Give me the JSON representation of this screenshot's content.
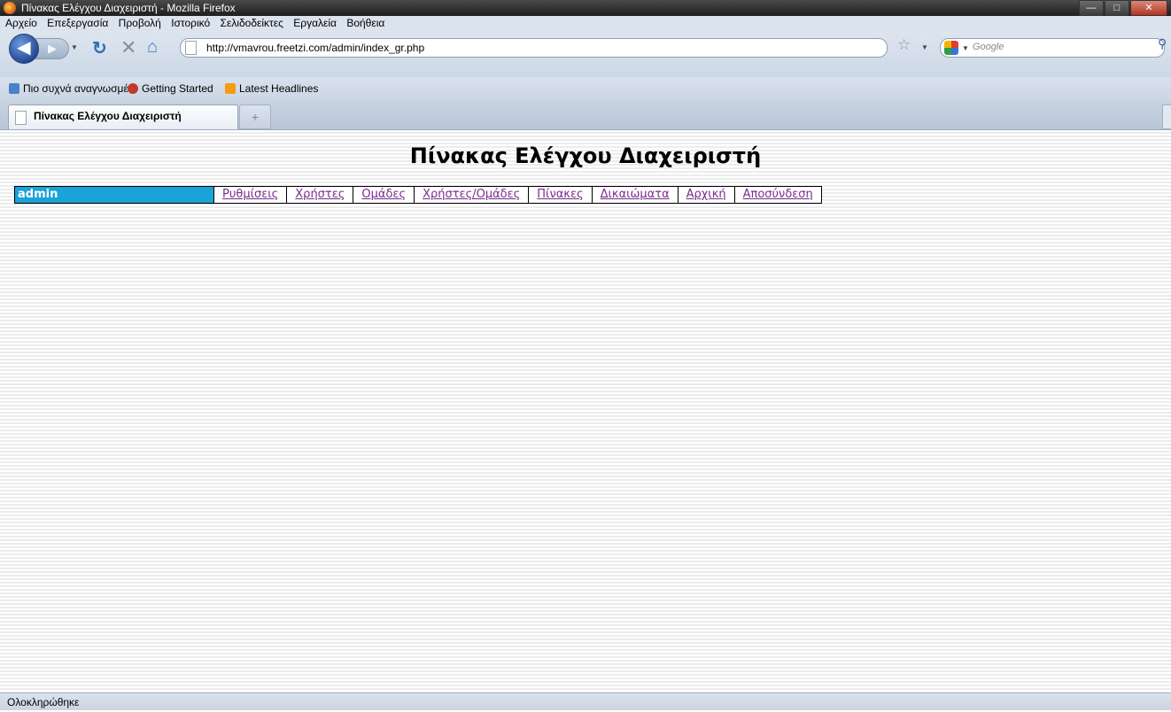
{
  "window": {
    "title": "Πίνακας Ελέγχου Διαχειριστή - Mozilla Firefox"
  },
  "menu": [
    "Αρχείο",
    "Επεξεργασία",
    "Προβολή",
    "Ιστορικό",
    "Σελιδοδείκτες",
    "Εργαλεία",
    "Βοήθεια"
  ],
  "navbar": {
    "url": "http://vmavrou.freetzi.com/admin/index_gr.php",
    "search_placeholder": "Google"
  },
  "bookmarks": [
    "Πιο συχνά αναγνωσμέ...",
    "Getting Started",
    "Latest Headlines"
  ],
  "tab": {
    "label": "Πίνακας Ελέγχου Διαχειριστή"
  },
  "page": {
    "title": "Πίνακας Ελέγχου Διαχειριστή",
    "user": "admin",
    "links": [
      "Ρυθμίσεις",
      "Χρήστες",
      "Ομάδες",
      "Χρήστες/Ομάδες",
      "Πίνακες",
      "Δικαιώματα",
      "Αρχική",
      "Αποσύνδεση"
    ]
  },
  "status": {
    "text": "Ολοκληρώθηκε"
  },
  "colors": {
    "user_cell": "#1aa3d6",
    "visited_link": "#7a2a8f"
  }
}
